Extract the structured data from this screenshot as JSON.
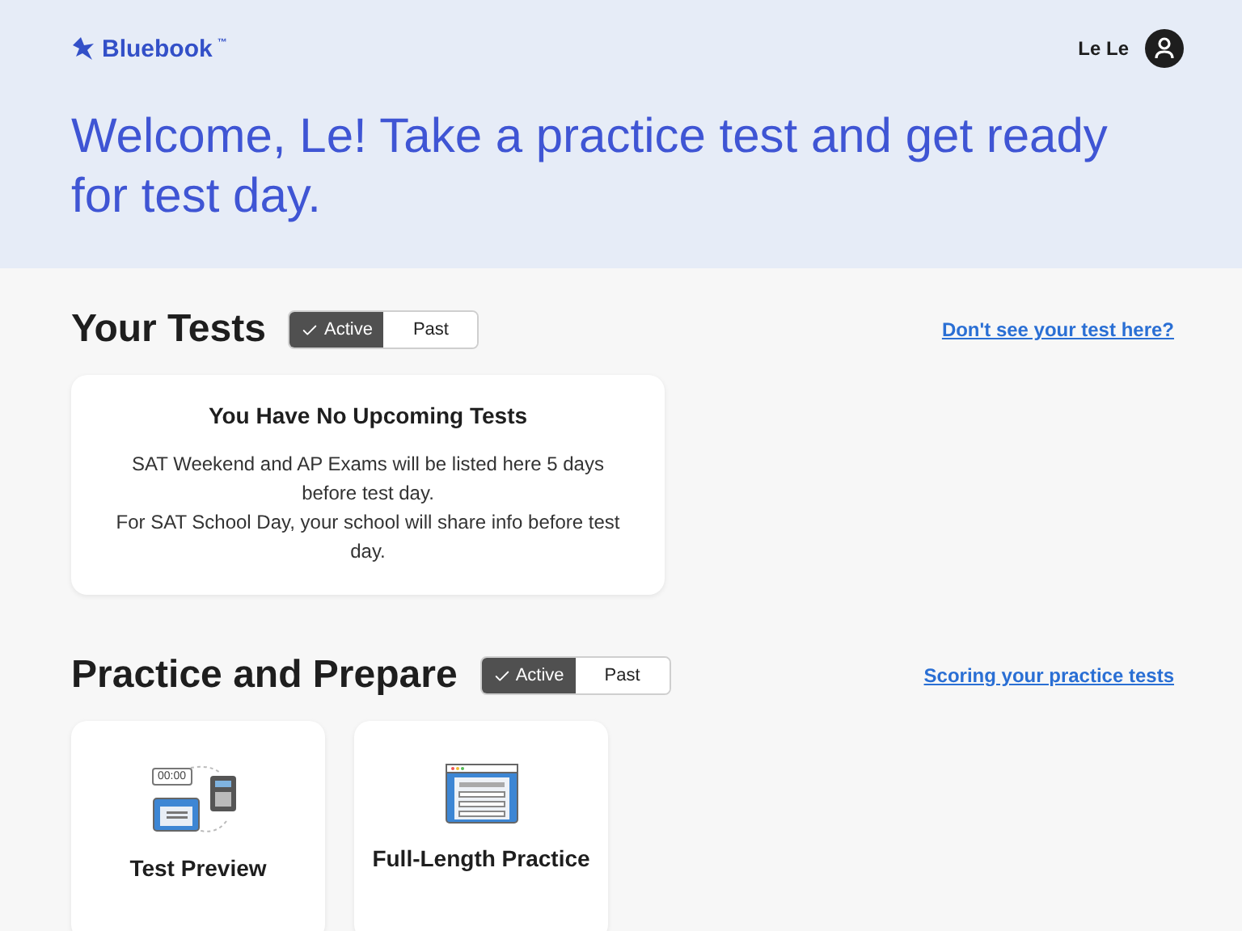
{
  "header": {
    "logo": "Bluebook",
    "logo_mark": "™",
    "user": "Le Le"
  },
  "welcome": "Welcome, Le! Take a practice test and get ready for test day.",
  "sections": [
    {
      "title": "Your Tests",
      "toggle": [
        {
          "label": "Active",
          "selected": true
        },
        {
          "label": "Past",
          "selected": false
        }
      ],
      "link": "Don't see your test here?",
      "empty_card": {
        "title": "You Have No Upcoming Tests",
        "lines": [
          "SAT Weekend and AP Exams will be listed here 5 days before test day.",
          "For SAT School Day, your school will share info before test day."
        ]
      }
    },
    {
      "title": "Practice and Prepare",
      "toggle": [
        {
          "label": "Active",
          "selected": true
        },
        {
          "label": "Past",
          "selected": false
        }
      ],
      "link": "Scoring your practice tests",
      "tiles": [
        {
          "kind": "preview",
          "label": "Test Preview",
          "timer": "00:00"
        },
        {
          "kind": "full",
          "label": "Full-Length Practice"
        }
      ]
    }
  ]
}
